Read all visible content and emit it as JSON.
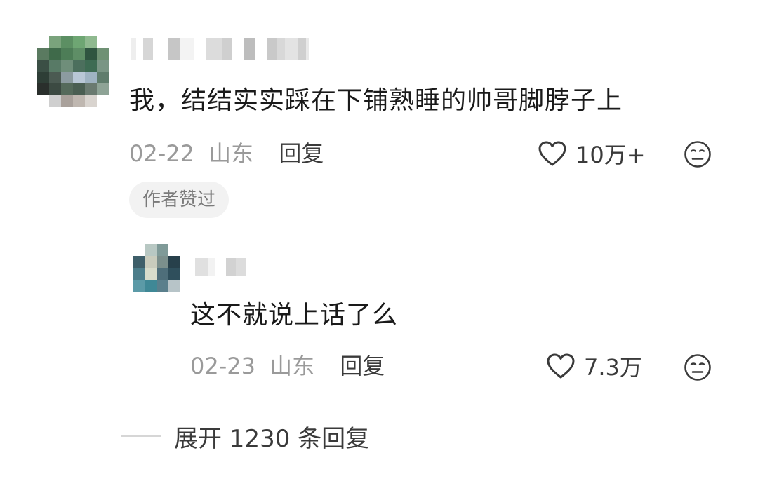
{
  "main_comment": {
    "text": "我，结结实实踩在下铺熟睡的帅哥脚脖子上",
    "date": "02-22",
    "location": "山东",
    "reply_label": "回复",
    "like_count": "10万+",
    "author_badge": "作者赞过",
    "avatar_icon": "blurred-avatar",
    "username_blurred": true
  },
  "reply_comment": {
    "text": "这不就说上话了么",
    "date": "02-23",
    "location": "山东",
    "reply_label": "回复",
    "like_count": "7.3万",
    "avatar_icon": "blurred-avatar",
    "username_blurred": true
  },
  "expand": {
    "label": "展开 1230 条回复"
  },
  "icons": {
    "like": "heart-outline-icon",
    "emoji": "neutral-face-icon"
  },
  "colors": {
    "text_primary": "#1a1a1a",
    "text_secondary": "#9a9a9a",
    "action_text": "#3a3a3a",
    "badge_bg": "#f2f2f2"
  }
}
